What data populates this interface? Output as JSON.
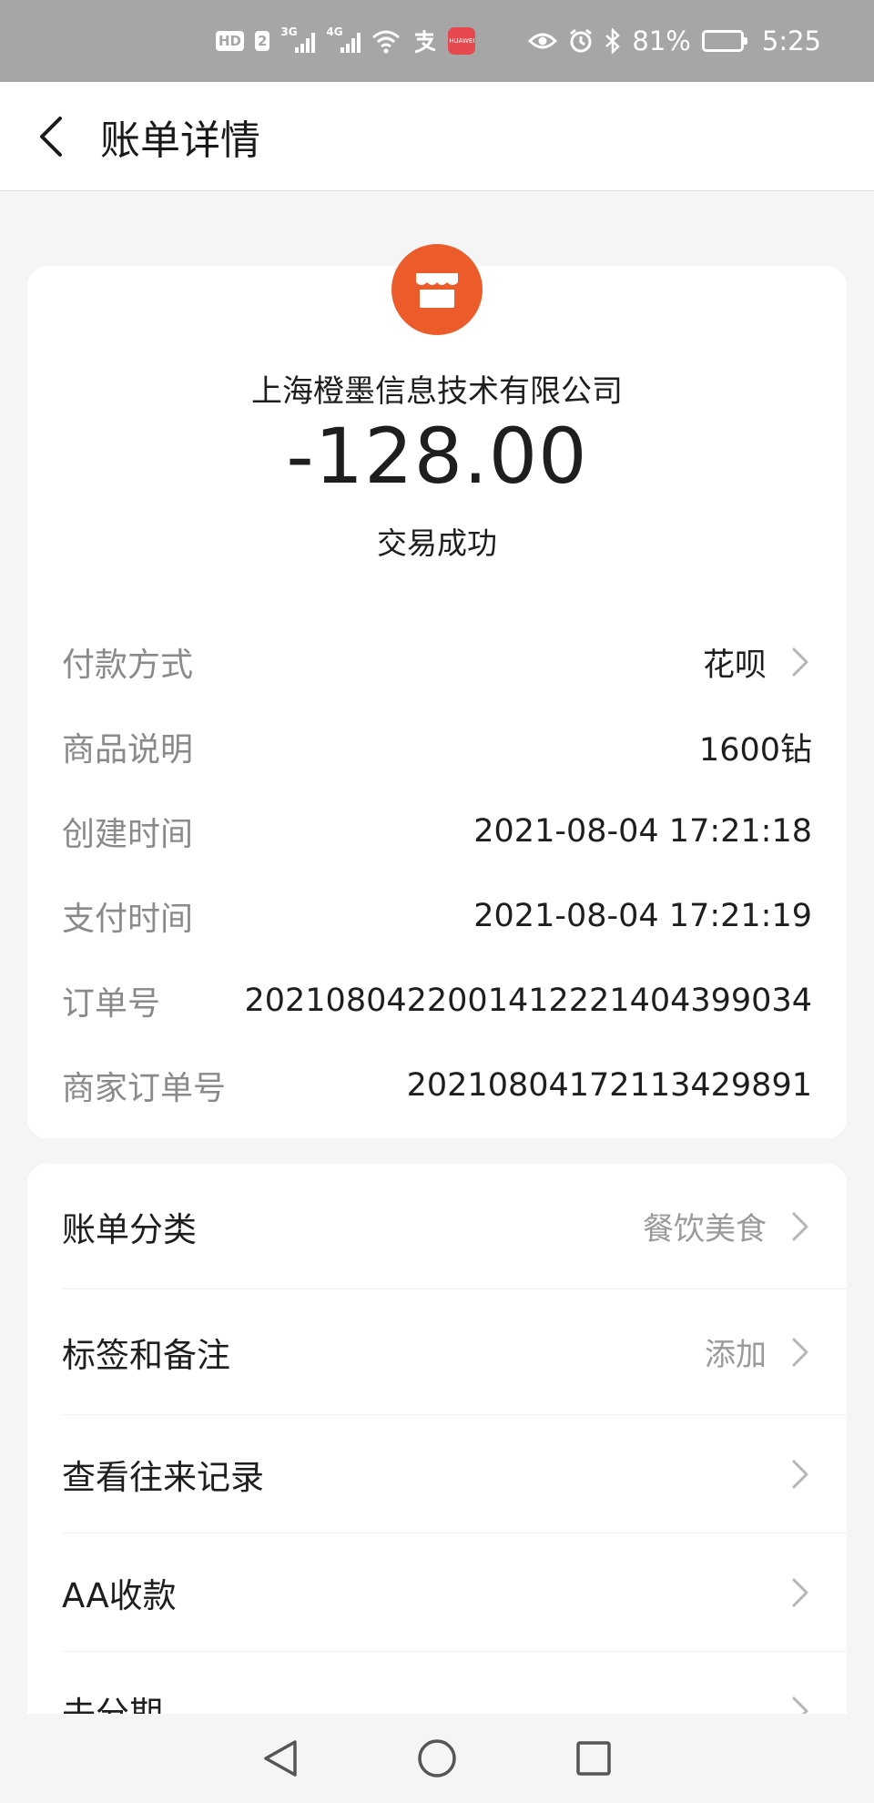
{
  "status_bar": {
    "badge_hd": "HD",
    "badge_sim": "2",
    "net1": "3G",
    "net2": "4G",
    "app_icon_text": "HUAWEI",
    "battery_pct": "81%",
    "battery_level": 0.81,
    "time": "5:25",
    "icons": [
      "signal-icon",
      "wifi-icon",
      "alipay-icon",
      "eye-icon",
      "alarm-icon",
      "bluetooth-icon",
      "battery-icon"
    ]
  },
  "header": {
    "title": "账单详情"
  },
  "merchant": {
    "name": "上海橙墨信息技术有限公司",
    "icon": "store-icon",
    "icon_color": "#ec5b2a"
  },
  "transaction": {
    "amount": "-128.00",
    "status": "交易成功"
  },
  "details": [
    {
      "label": "付款方式",
      "value": "花呗"
    },
    {
      "label": "商品说明",
      "value": "1600钻"
    },
    {
      "label": "创建时间",
      "value": "2021-08-04 17:21:18"
    },
    {
      "label": "支付时间",
      "value": "2021-08-04 17:21:19"
    },
    {
      "label": "订单号",
      "value": "2021080422001412221404399034"
    },
    {
      "label": "商家订单号",
      "value": "20210804172113429891"
    }
  ],
  "menu": [
    {
      "label": "账单分类",
      "value": "餐饮美食"
    },
    {
      "label": "标签和备注",
      "value": "添加"
    },
    {
      "label": "查看往来记录",
      "value": ""
    },
    {
      "label": "AA收款",
      "value": ""
    },
    {
      "label": "去分期",
      "value": ""
    }
  ],
  "nav": [
    "back-triangle-icon",
    "home-circle-icon",
    "recents-square-icon"
  ]
}
